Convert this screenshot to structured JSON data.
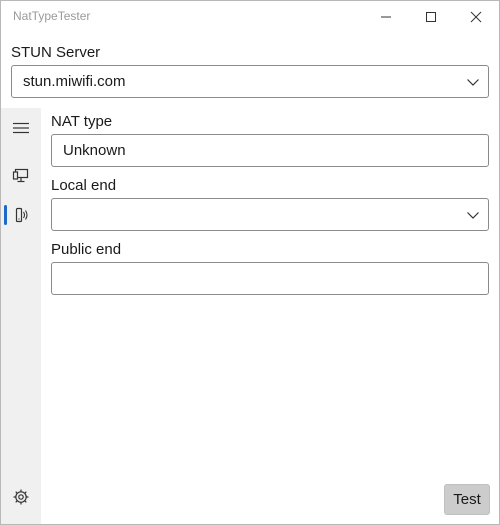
{
  "window": {
    "title": "NatTypeTester",
    "controls": [
      "minimize-icon",
      "maximize-icon",
      "close-icon"
    ]
  },
  "stun_server": {
    "label": "STUN Server",
    "value": "stun.miwifi.com"
  },
  "nav_rail": {
    "items": [
      "hamburger-icon",
      "monitor-icon",
      "network-test-icon"
    ],
    "selected": "network-test-icon",
    "footer": "settings-icon"
  },
  "nat_type": {
    "label": "NAT type",
    "value": "Unknown"
  },
  "local_end": {
    "label": "Local end",
    "value": ""
  },
  "public_end": {
    "label": "Public end",
    "value": ""
  },
  "actions": {
    "test_label": "Test"
  },
  "colors": {
    "accent": "#1b6ac9",
    "rail_bg": "#f0f0f0",
    "button_bg": "#cccccc"
  }
}
